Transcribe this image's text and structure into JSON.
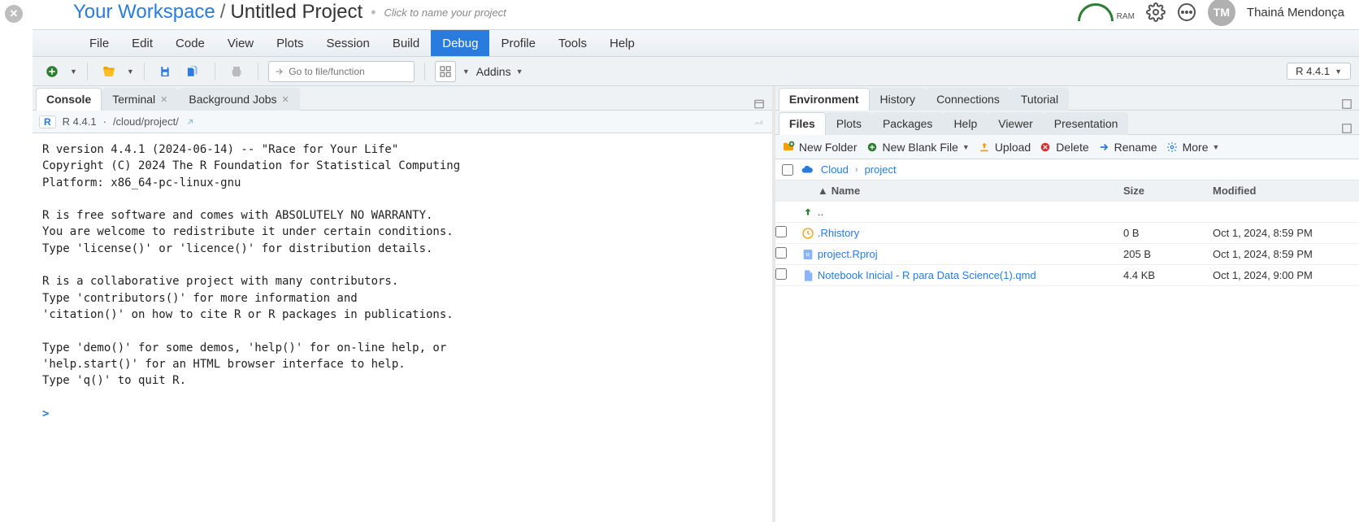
{
  "header": {
    "workspace": "Your Workspace",
    "project": "Untitled Project",
    "hint": "Click to name your project",
    "ram_label": "RAM",
    "user_initials": "TM",
    "user_name": "Thainá Mendonça"
  },
  "menu": {
    "items": [
      "File",
      "Edit",
      "Code",
      "View",
      "Plots",
      "Session",
      "Build",
      "Debug",
      "Profile",
      "Tools",
      "Help"
    ],
    "active": "Debug"
  },
  "toolbar": {
    "goto_placeholder": "Go to file/function",
    "addins_label": "Addins",
    "r_version": "R 4.4.1"
  },
  "left": {
    "tabs": [
      "Console",
      "Terminal",
      "Background Jobs"
    ],
    "active": "Console",
    "subbar": {
      "r_version": "R 4.4.1",
      "sep": "·",
      "path": "/cloud/project/"
    },
    "console_text": "R version 4.4.1 (2024-06-14) -- \"Race for Your Life\"\nCopyright (C) 2024 The R Foundation for Statistical Computing\nPlatform: x86_64-pc-linux-gnu\n\nR is free software and comes with ABSOLUTELY NO WARRANTY.\nYou are welcome to redistribute it under certain conditions.\nType 'license()' or 'licence()' for distribution details.\n\nR is a collaborative project with many contributors.\nType 'contributors()' for more information and\n'citation()' on how to cite R or R packages in publications.\n\nType 'demo()' for some demos, 'help()' for on-line help, or\n'help.start()' for an HTML browser interface to help.\nType 'q()' to quit R.\n",
    "prompt": ">"
  },
  "right_top": {
    "tabs": [
      "Environment",
      "History",
      "Connections",
      "Tutorial"
    ],
    "active": "Environment"
  },
  "right_bottom": {
    "tabs": [
      "Files",
      "Plots",
      "Packages",
      "Help",
      "Viewer",
      "Presentation"
    ],
    "active": "Files",
    "toolbar": {
      "new_folder": "New Folder",
      "new_blank": "New Blank File",
      "upload": "Upload",
      "delete": "Delete",
      "rename": "Rename",
      "more": "More"
    },
    "breadcrumb": {
      "root": "Cloud",
      "path": "project"
    },
    "columns": {
      "name": "Name",
      "size": "Size",
      "modified": "Modified"
    },
    "up_label": "..",
    "rows": [
      {
        "icon": "history",
        "name": ".Rhistory",
        "size": "0 B",
        "modified": "Oct 1, 2024, 8:59 PM"
      },
      {
        "icon": "rproj",
        "name": "project.Rproj",
        "size": "205 B",
        "modified": "Oct 1, 2024, 8:59 PM"
      },
      {
        "icon": "qmd",
        "name": "Notebook Inicial - R para Data Science(1).qmd",
        "size": "4.4 KB",
        "modified": "Oct 1, 2024, 9:00 PM"
      }
    ]
  }
}
